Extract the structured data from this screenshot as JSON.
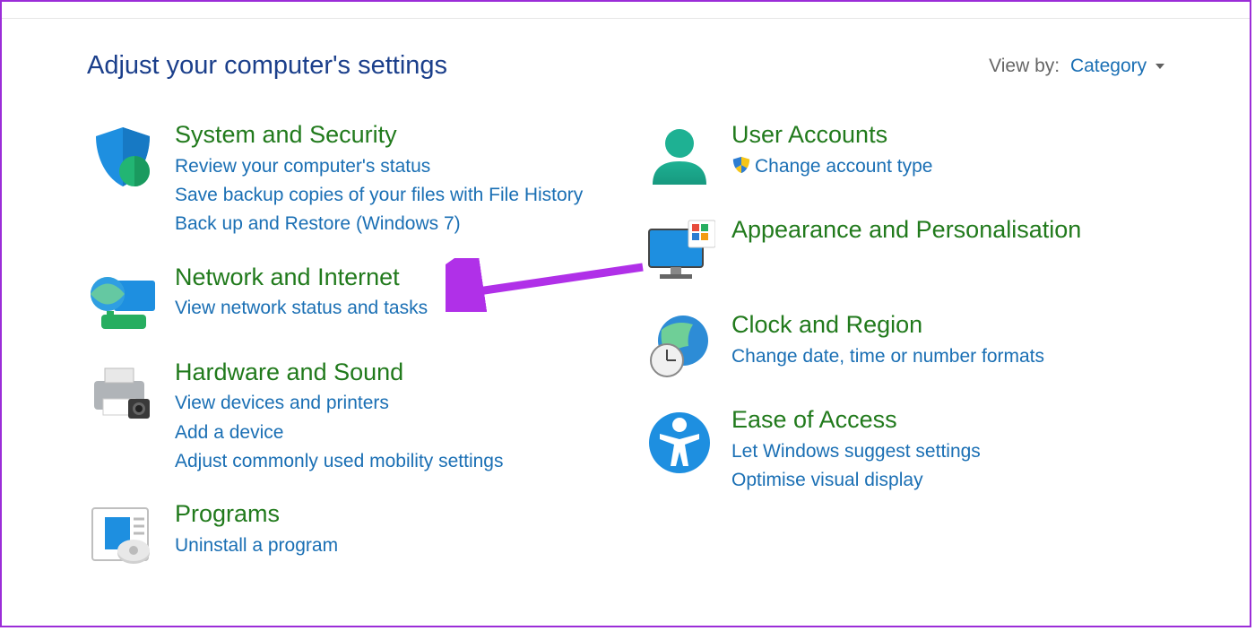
{
  "header": {
    "title": "Adjust your computer's settings",
    "view_by_label": "View by:",
    "view_by_value": "Category"
  },
  "categories": {
    "system_security": {
      "title": "System and Security",
      "links": [
        "Review your computer's status",
        "Save backup copies of your files with File History",
        "Back up and Restore (Windows 7)"
      ]
    },
    "network_internet": {
      "title": "Network and Internet",
      "links": [
        "View network status and tasks"
      ]
    },
    "hardware_sound": {
      "title": "Hardware and Sound",
      "links": [
        "View devices and printers",
        "Add a device",
        "Adjust commonly used mobility settings"
      ]
    },
    "programs": {
      "title": "Programs",
      "links": [
        "Uninstall a program"
      ]
    },
    "user_accounts": {
      "title": "User Accounts",
      "links": [
        "Change account type"
      ]
    },
    "appearance": {
      "title": "Appearance and Personalisation"
    },
    "clock_region": {
      "title": "Clock and Region",
      "links": [
        "Change date, time or number formats"
      ]
    },
    "ease_access": {
      "title": "Ease of Access",
      "links": [
        "Let Windows suggest settings",
        "Optimise visual display"
      ]
    }
  }
}
